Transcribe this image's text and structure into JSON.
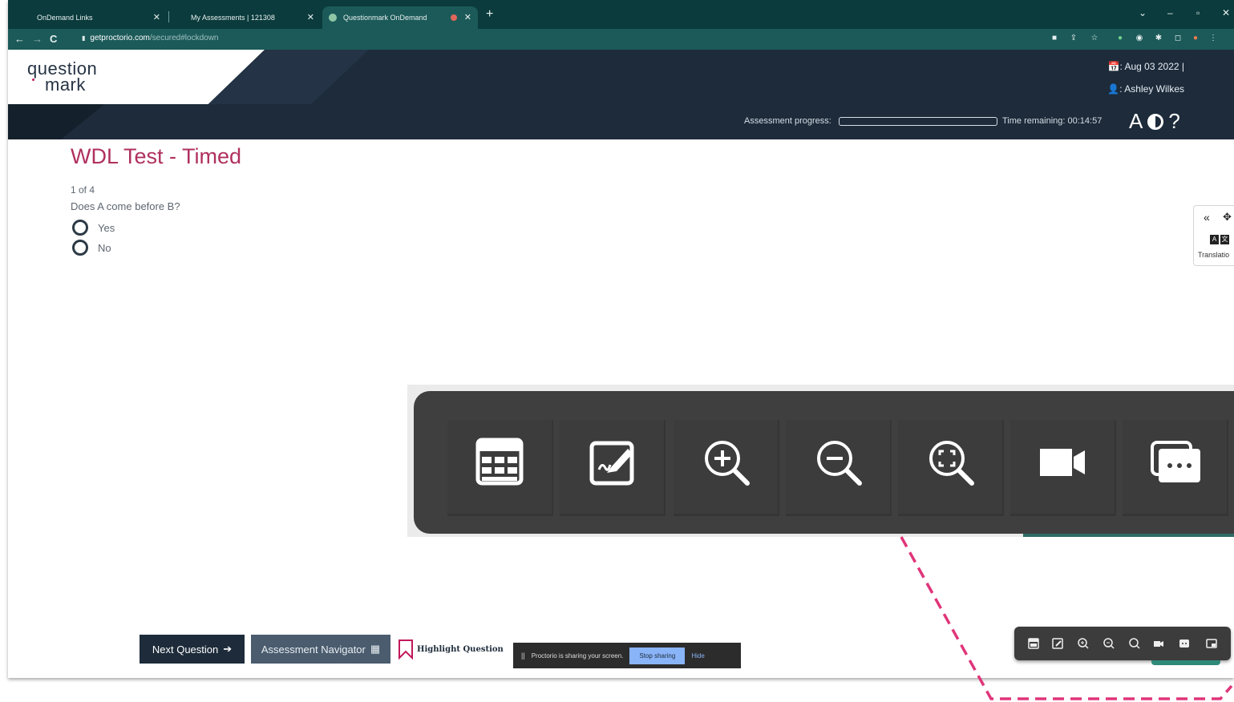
{
  "browser": {
    "tabs": [
      {
        "label": "OnDemand Links"
      },
      {
        "label": "My Assessments | 121308"
      },
      {
        "label": "Questionmark OnDemand"
      }
    ],
    "url_domain": "getproctorio.com",
    "url_path": "/secured#lockdown",
    "new_tab": "+",
    "window_controls": [
      "⌄",
      "–",
      "▫",
      "✕"
    ],
    "nav": {
      "back": "←",
      "forward": "→",
      "reload": "C",
      "lock": "🔒"
    }
  },
  "app": {
    "logo_line1": "question",
    "logo_line2": "mark",
    "date_text": "📅: Aug 03 2022 |",
    "user_text": "👤: Ashley Wilkes",
    "progress_label": "Assessment progress:",
    "progress_fraction": 0,
    "time_label": "Time remaining: 00:14:57",
    "font_size_glyph": "A",
    "help_glyph": "?"
  },
  "question": {
    "title": "WDL Test - Timed",
    "counter": "1  of 4",
    "text": "Does A come before B?",
    "options": [
      {
        "label": "Yes"
      },
      {
        "label": "No"
      }
    ]
  },
  "translation_widget": {
    "collapse_glyph": "«",
    "move_glyph": "✥",
    "icon_a": "A",
    "icon_b": "文",
    "label": "Translatio"
  },
  "zoomed_toolbar": {
    "tools": [
      {
        "name": "calculator-icon"
      },
      {
        "name": "scratchpad-icon"
      },
      {
        "name": "zoom-in-icon"
      },
      {
        "name": "zoom-out-icon"
      },
      {
        "name": "zoom-reset-icon"
      },
      {
        "name": "camera-icon"
      },
      {
        "name": "chat-icon"
      }
    ]
  },
  "footer": {
    "next_label": "Next Question",
    "navigator_label": "Assessment Navigator",
    "highlight_label": "Highlight Question",
    "share_text": "Proctorio is sharing your screen.",
    "share_pause": "||",
    "share_stop": "Stop sharing",
    "share_hide": "Hide"
  },
  "colors": {
    "brand_dark": "#1d2b3a",
    "title_accent": "#b0305f",
    "browser_teal": "#1b5a59",
    "callout_pink": "#e0357a"
  }
}
